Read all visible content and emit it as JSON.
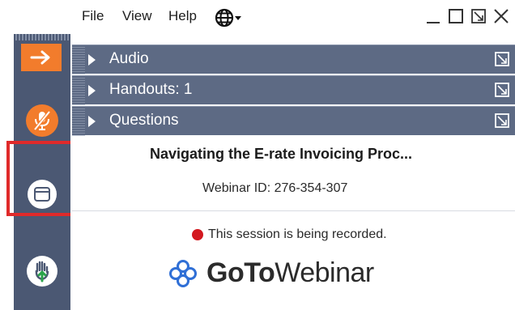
{
  "menu": {
    "file": "File",
    "view": "View",
    "help": "Help"
  },
  "sections": [
    {
      "label": "Audio"
    },
    {
      "label": "Handouts: 1"
    },
    {
      "label": "Questions"
    }
  ],
  "session": {
    "title": "Navigating the E-rate Invoicing Proc...",
    "webinar_id": "Webinar ID: 276-354-307",
    "recording_notice": "This session is being recorded."
  },
  "logo": {
    "goto": "GoTo",
    "webinar": "Webinar"
  },
  "colors": {
    "toolbar_bg": "#4b5873",
    "section_bg": "#5d6a84",
    "accent_orange": "#f27c2c",
    "highlight_red": "#e02a2a",
    "record_red": "#d3181f",
    "logo_blue": "#2f6fd6"
  },
  "icons": {
    "toolbar": [
      "arrow-right-icon",
      "microphone-muted-icon",
      "window-icon",
      "raise-hand-icon"
    ],
    "menubar": [
      "globe-icon",
      "minimize-icon",
      "restore-icon",
      "popout-icon",
      "close-icon"
    ],
    "logo": "gotowebinar-flower-icon"
  }
}
